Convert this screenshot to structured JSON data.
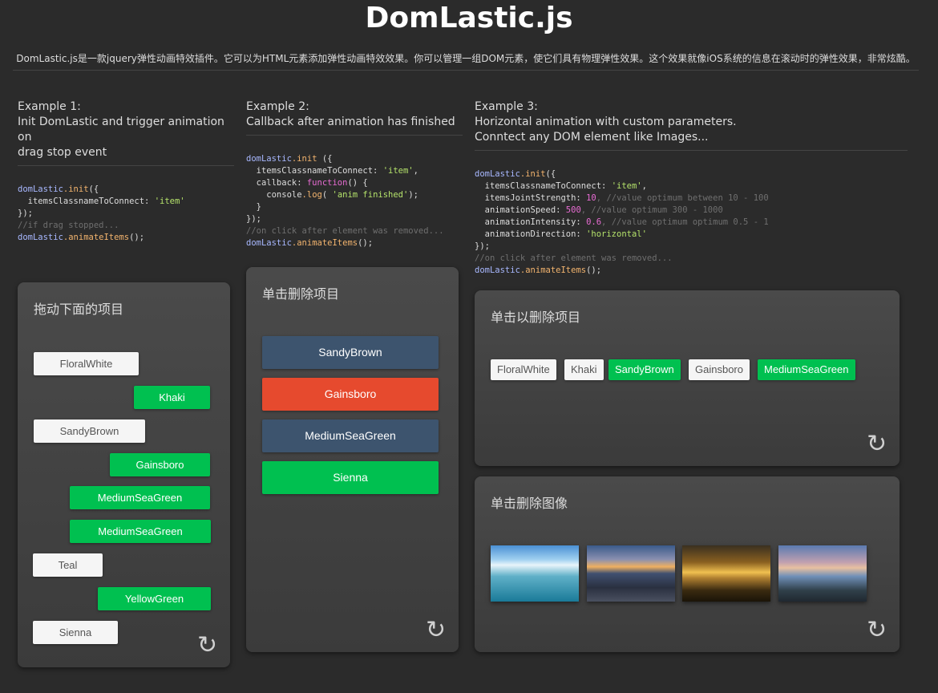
{
  "page": {
    "title": "DomLastic.js",
    "description": "DomLastic.js是一款jquery弹性动画特效插件。它可以为HTML元素添加弹性动画特效效果。你可以管理一组DOM元素，使它们具有物理弹性效果。这个效果就像iOS系统的信息在滚动时的弹性效果，非常炫酷。"
  },
  "example1": {
    "heading_line1": "Example 1:",
    "heading_line2": "Init DomLastic and trigger animation on",
    "heading_line3": "drag stop event",
    "code": {
      "l1_obj": "domLastic",
      "l1_fn": ".init",
      "l1_rest": "({",
      "l2_key": "  itemsClassnameToConnect: ",
      "l2_str": "'item'",
      "l3": "});",
      "l4_com": "//if drag stopped...",
      "l5_obj": "domLastic",
      "l5_fn": ".animateItems",
      "l5_rest": "();"
    },
    "panel_title": "拖动下面的项目",
    "items": [
      "FloralWhite",
      "Khaki",
      "SandyBrown",
      "Gainsboro",
      "MediumSeaGreen",
      "MediumSeaGreen",
      "Teal",
      "YellowGreen",
      "Sienna"
    ],
    "refresh_icon": "↻"
  },
  "example2": {
    "heading_line1": "Example 2:",
    "heading_line2": "Callback after animation has finished",
    "code": {
      "l1_obj": "domLastic",
      "l1_fn": ".init",
      "l1_rest": " ({",
      "l2_key": "  itemsClassnameToConnect: ",
      "l2_str": "'item'",
      "l2_end": ",",
      "l3_key": "  callback: ",
      "l3_kw": "function",
      "l3_rest": "() {",
      "l4_a": "    console",
      "l4_b": ".log",
      "l4_c": "( ",
      "l4_str": "'anim finished'",
      "l4_end": ");",
      "l5": "  }",
      "l6": "});",
      "l7_com": "//on click after element was removed...",
      "l8_obj": "domLastic",
      "l8_fn": ".animateItems",
      "l8_rest": "();"
    },
    "panel_title": "单击删除项目",
    "buttons": [
      {
        "label": "SandyBrown",
        "color": "#3d546e"
      },
      {
        "label": "Gainsboro",
        "color": "#e64a2e"
      },
      {
        "label": "MediumSeaGreen",
        "color": "#3d546e"
      },
      {
        "label": "Sienna",
        "color": "#00c050"
      }
    ],
    "refresh_icon": "↻"
  },
  "example3": {
    "heading_line1": "Example 3:",
    "heading_line2": "Horizontal animation with custom parameters.",
    "heading_line3": "Conntect any DOM element like Images...",
    "code": {
      "l1_obj": "domLastic",
      "l1_fn": ".init",
      "l1_rest": "({",
      "l2_key": "  itemsClassnameToConnect: ",
      "l2_str": "'item'",
      "l2_end": ",",
      "l3_key": "  itemsJointStrength: ",
      "l3_num": "10",
      "l3_com": ", //value optimum between 10 - 100",
      "l4_key": "  animationSpeed: ",
      "l4_num": "500",
      "l4_com": ", //value optimum 300 - 1000",
      "l5_key": "  animationIntensity: ",
      "l5_num": "0.6",
      "l5_com": ", //value optimum optimum 0.5 - 1",
      "l6_key": "  animationDirection: ",
      "l6_str": "'horizontal'",
      "l7": "});",
      "l8_com": "//on click after element was removed...",
      "l9_obj": "domLastic",
      "l9_fn": ".animateItems",
      "l9_rest": "();"
    },
    "panel1_title": "单击以删除项目",
    "items": [
      "FloralWhite",
      "Khaki",
      "SandyBrown",
      "Gainsboro",
      "MediumSeaGreen"
    ],
    "panel2_title": "单击删除图像",
    "refresh_icon": "↻"
  }
}
